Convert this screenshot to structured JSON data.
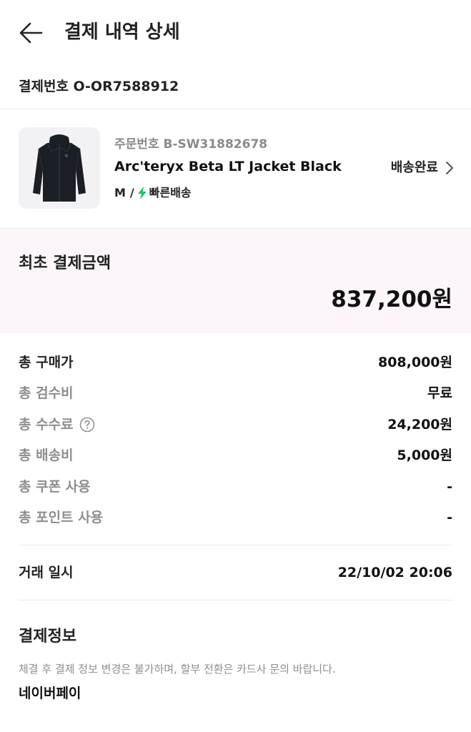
{
  "header": {
    "title": "결제 내역 상세"
  },
  "payment_number": "결제번호 O-OR7588912",
  "product": {
    "order_number": "주문번호 B-SW31882678",
    "name": "Arc'teryx Beta LT Jacket Black",
    "size": "M",
    "separator": "/",
    "shipping_type": "빠른배송",
    "status": "배송완료"
  },
  "colors": {
    "accent_green": "#21c16b",
    "total_bg": "#fcf6fa"
  },
  "total": {
    "label": "최초 결제금액",
    "amount": "837,200원"
  },
  "breakdown": [
    {
      "label": "총 구매가",
      "value": "808,000원"
    },
    {
      "label": "총 검수비",
      "value": "무료"
    },
    {
      "label": "총 수수료",
      "value": "24,200원"
    },
    {
      "label": "총 배송비",
      "value": "5,000원"
    },
    {
      "label": "총 쿠폰 사용",
      "value": "-"
    },
    {
      "label": "총 포인트 사용",
      "value": "-"
    }
  ],
  "transaction": {
    "label": "거래 일시",
    "value": "22/10/02 20:06"
  },
  "payment_info": {
    "title": "결제정보",
    "note": "체결 후 결제 정보 변경은 불가하며, 할부 전환은 카드사 문의 바랍니다.",
    "method": "네이버페이"
  }
}
